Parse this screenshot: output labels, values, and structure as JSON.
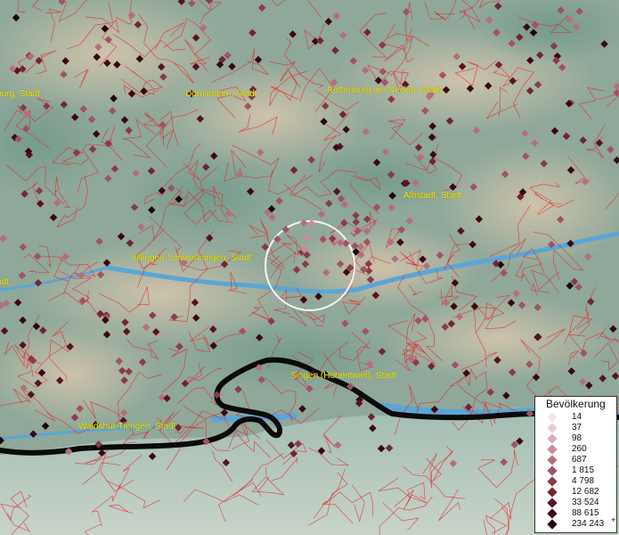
{
  "map": {
    "places": [
      {
        "name": "burg, Stadt"
      },
      {
        "name": "Dornstetten, Stadt"
      },
      {
        "name": "Rottenburg am Neckar, Stadt"
      },
      {
        "name": "Albstadt, Stadt"
      },
      {
        "name": "Villingen-Schwenningen, Stadt"
      },
      {
        "name": "adt"
      },
      {
        "name": "Singen (Hohentwiel), Stadt"
      },
      {
        "name": "Waldshut-Tiengen, Stadt"
      }
    ],
    "colors": {
      "terrain": "#8fa89a",
      "boundaries": "#e8242a",
      "water": "#5aa6d6",
      "border": "#000000",
      "label": "#e6e61a"
    }
  },
  "legend": {
    "title": "Bevölkerung",
    "items": [
      {
        "label": "14",
        "color": "#f7e4ec"
      },
      {
        "label": "37",
        "color": "#ecc8d3"
      },
      {
        "label": "98",
        "color": "#dcaab8"
      },
      {
        "label": "260",
        "color": "#c98c9b"
      },
      {
        "label": "687",
        "color": "#b56f7e"
      },
      {
        "label": "1 815",
        "color": "#a05364"
      },
      {
        "label": "4 798",
        "color": "#8a3a4b"
      },
      {
        "label": "12 682",
        "color": "#722434"
      },
      {
        "label": "33 524",
        "color": "#571321"
      },
      {
        "label": "88 615",
        "color": "#3b0812"
      },
      {
        "label": "234 243",
        "color": "#1c0206",
        "plus": "+"
      }
    ]
  }
}
